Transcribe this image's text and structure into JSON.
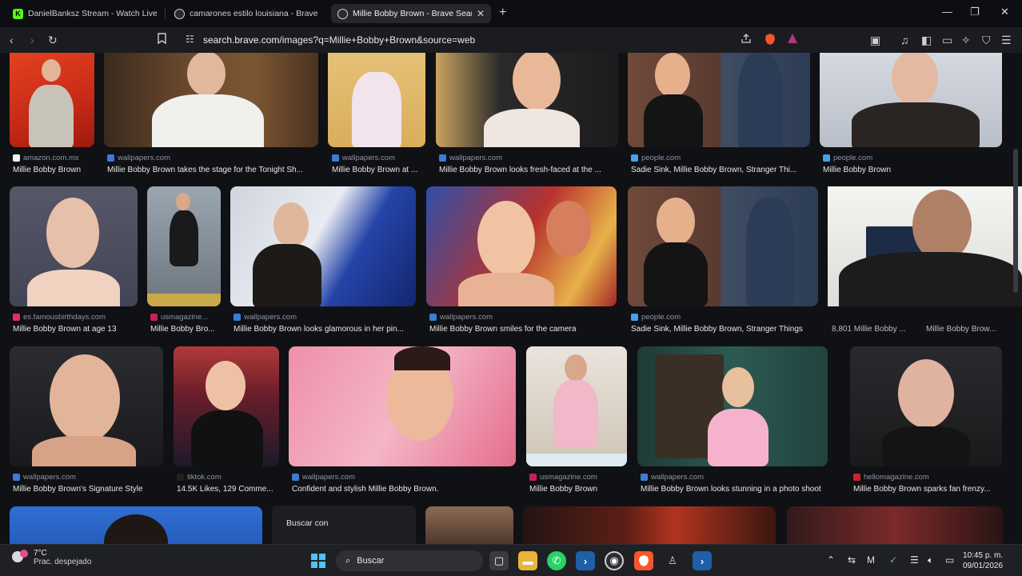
{
  "tabs": [
    {
      "title": "DanielBanksz Stream - Watch Live on",
      "active": false
    },
    {
      "title": "camarones estilo louisiana - Brave Se",
      "active": false
    },
    {
      "title": "Millie Bobby Brown - Brave Sear",
      "active": true
    }
  ],
  "window_controls": {
    "minimize": "—",
    "restore": "❐",
    "close": "✕"
  },
  "address_bar": {
    "url_site": "search.brave.com",
    "url_rest": "/images?q=Millie+Bobby+Brown&source=web"
  },
  "results": [
    {
      "source": "amazon.com.mx",
      "caption": "Millie Bobby Brown",
      "source_color": "#f2f2f2"
    },
    {
      "source": "wallpapers.com",
      "caption": "Millie Bobby Brown takes the stage for the Tonight Sh...",
      "source_color": "#3d7bd8"
    },
    {
      "source": "wallpapers.com",
      "caption": "Millie Bobby Brown at ...",
      "source_color": "#3d7bd8"
    },
    {
      "source": "wallpapers.com",
      "caption": "Millie Bobby Brown looks fresh-faced at the ...",
      "source_color": "#3d7bd8"
    },
    {
      "source": "people.com",
      "caption": "Sadie Sink, Millie Bobby Brown, Stranger Thi...",
      "source_color": "#3fa4e8"
    },
    {
      "source": "people.com",
      "caption": "Millie Bobby Brown",
      "source_color": "#3fa4e8"
    },
    {
      "source": "es.famousbirthdays.com",
      "caption": "Millie Bobby Brown at age 13",
      "source_color": "#e0306a"
    },
    {
      "source": "usmagazine...",
      "caption": "Millie Bobby Bro...",
      "source_color": "#c8205a"
    },
    {
      "source": "wallpapers.com",
      "caption": "Millie Bobby Brown looks glamorous in her pin...",
      "source_color": "#3d7bd8"
    },
    {
      "source": "wallpapers.com",
      "caption": "Millie Bobby Brown smiles for the camera",
      "source_color": "#3d7bd8"
    },
    {
      "source": "people.com",
      "caption": "Sadie Sink, Millie Bobby Brown, Stranger Things",
      "source_color": "#3fa4e8"
    },
    {
      "source": "",
      "caption": "8,801 Millie Bobby ...",
      "source_color": "#777777"
    },
    {
      "source": "",
      "caption": "Millie Bobby Brow...",
      "source_color": "#777777"
    },
    {
      "source": "wallpapers.com",
      "caption": "Millie Bobby Brown's Signature Style",
      "source_color": "#3d7bd8"
    },
    {
      "source": "tiktok.com",
      "caption": "14.5K Likes, 129 Comme...",
      "source_color": "#222222"
    },
    {
      "source": "wallpapers.com",
      "caption": "Confident and stylish Millie Bobby Brown.",
      "source_color": "#3d7bd8"
    },
    {
      "source": "usmagazine.com",
      "caption": "Millie Bobby Brown",
      "source_color": "#c8205a"
    },
    {
      "source": "wallpapers.com",
      "caption": "Millie Bobby Brown looks stunning in a photo shoot",
      "source_color": "#3d7bd8"
    },
    {
      "source": "hellomagazine.com",
      "caption": "Millie Bobby Brown sparks fan frenzy...",
      "source_color": "#d0202a"
    }
  ],
  "popup": {
    "label": "Buscar con"
  },
  "taskbar": {
    "temperature": "7°C",
    "condition": "Prac. despejado",
    "search_label": "Buscar",
    "time": "10:45 p. m.",
    "date": "09/01/2026"
  },
  "colors": {
    "brave": "#fb542b",
    "accent": "#3d7bd8"
  }
}
